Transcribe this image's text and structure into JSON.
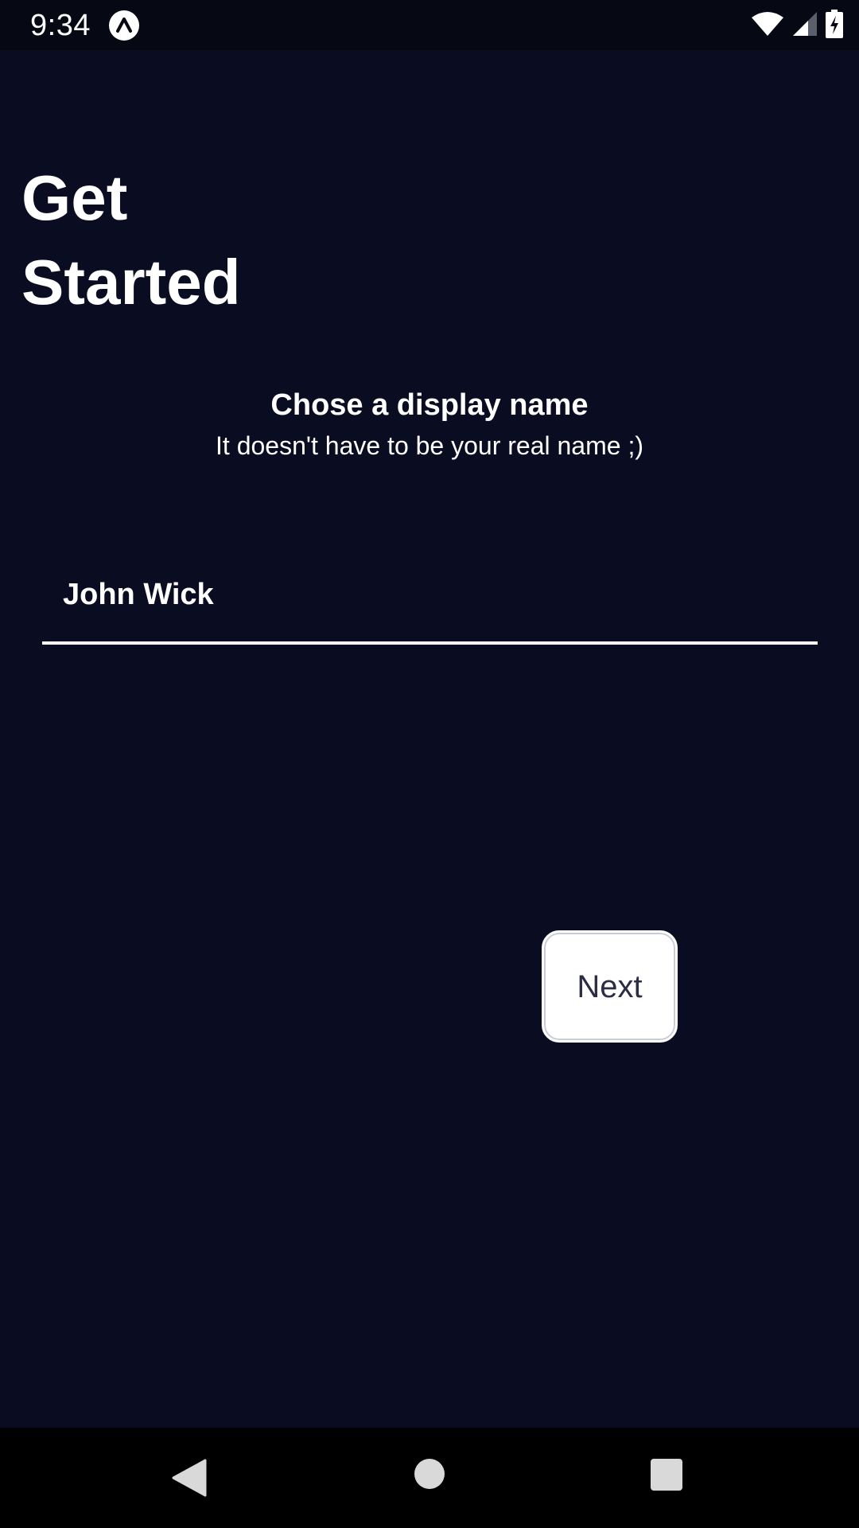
{
  "status_bar": {
    "time": "9:34",
    "app_icon": "expo-icon",
    "wifi_icon": "wifi-icon",
    "signal_icon": "cell-signal-icon",
    "battery_icon": "battery-charging-icon"
  },
  "header": {
    "title_line1": "Get",
    "title_line2": "Started"
  },
  "prompt": {
    "heading": "Chose a display name",
    "subheading": "It doesn't have to be your real name ;)"
  },
  "name_input": {
    "value": "John Wick"
  },
  "actions": {
    "next_label": "Next"
  },
  "nav_bar": {
    "back_icon": "back-triangle-icon",
    "home_icon": "home-circle-icon",
    "recents_icon": "recents-square-icon"
  },
  "colors": {
    "background": "#0a0d21",
    "status_bar": "#060814",
    "nav_bar": "#000000",
    "text": "#ffffff",
    "button_text": "#2b2d45"
  }
}
